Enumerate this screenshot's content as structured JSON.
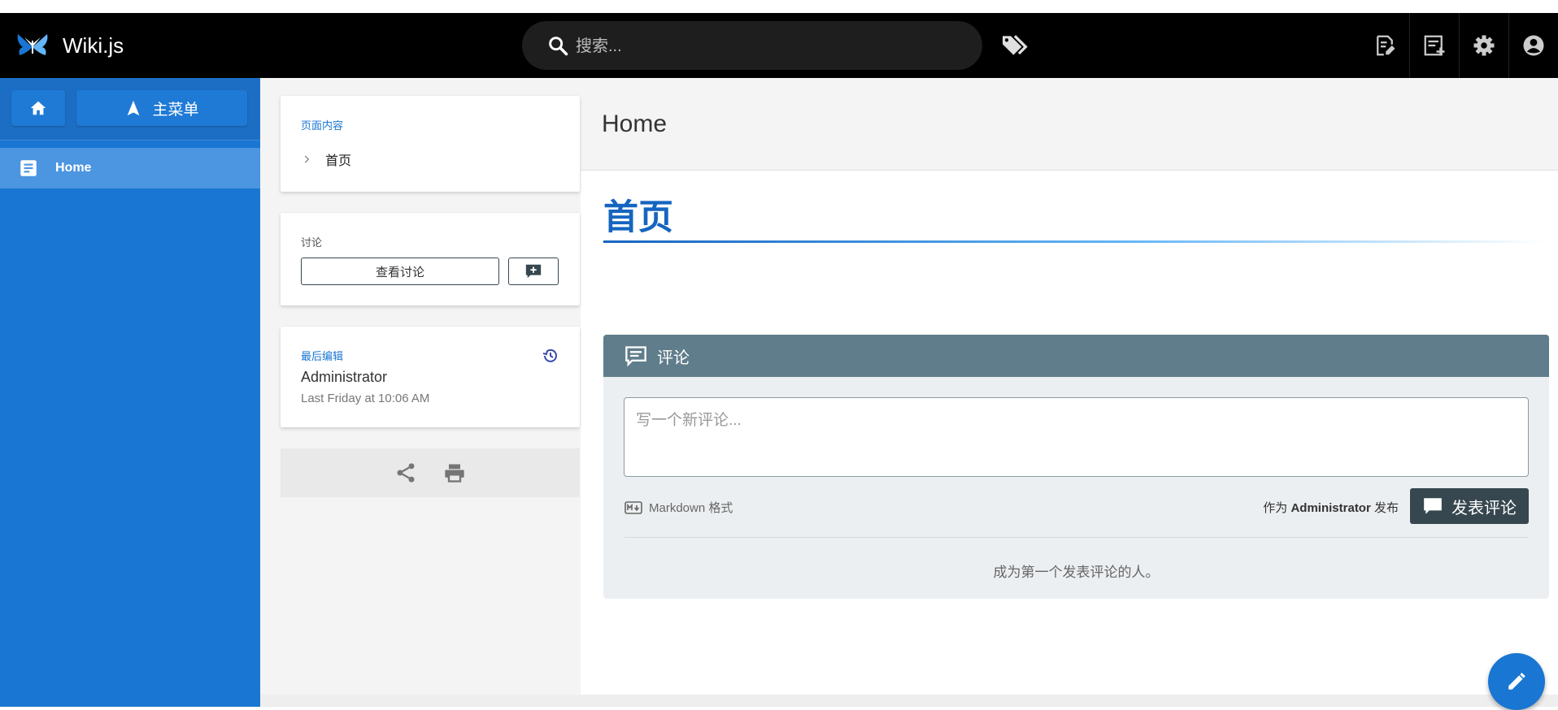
{
  "app": {
    "title": "Wiki.js"
  },
  "search": {
    "placeholder": "搜索..."
  },
  "sidebar": {
    "menu_label": "主菜单",
    "items": [
      {
        "label": "Home",
        "active": true
      }
    ]
  },
  "page": {
    "header_title": "Home",
    "content_title": "首页"
  },
  "toc": {
    "label": "页面内容",
    "items": [
      "首页"
    ]
  },
  "discussion": {
    "label": "讨论",
    "view_label": "查看讨论"
  },
  "last_edit": {
    "label": "最后编辑",
    "author": "Administrator",
    "time": "Last Friday at 10:06 AM"
  },
  "comments": {
    "title": "评论",
    "placeholder": "写一个新评论...",
    "markdown_hint": "Markdown 格式",
    "post_as_prefix": "作为",
    "post_as_user": "Administrator",
    "post_as_suffix": "发布",
    "post_button": "发表评论",
    "empty_text": "成为第一个发表评论的人。"
  },
  "colors": {
    "appbar": "#000000",
    "sidebar": "#1976d2",
    "accent": "#1565c0",
    "comments_header": "#607d8b",
    "post_button": "#37474f"
  },
  "icons": {
    "logo": "wikijs-logo",
    "search": "search-icon",
    "tags": "tags-icon",
    "new_page": "new-page-icon",
    "edit_page": "edit-page-icon",
    "settings": "gear-icon",
    "account": "account-icon",
    "home": "home-icon",
    "navigation": "navigation-icon",
    "page": "page-icon",
    "history": "history-icon",
    "share": "share-icon",
    "print": "print-icon",
    "comment": "comment-icon",
    "markdown": "markdown-icon",
    "edit_fab": "pencil-icon"
  }
}
